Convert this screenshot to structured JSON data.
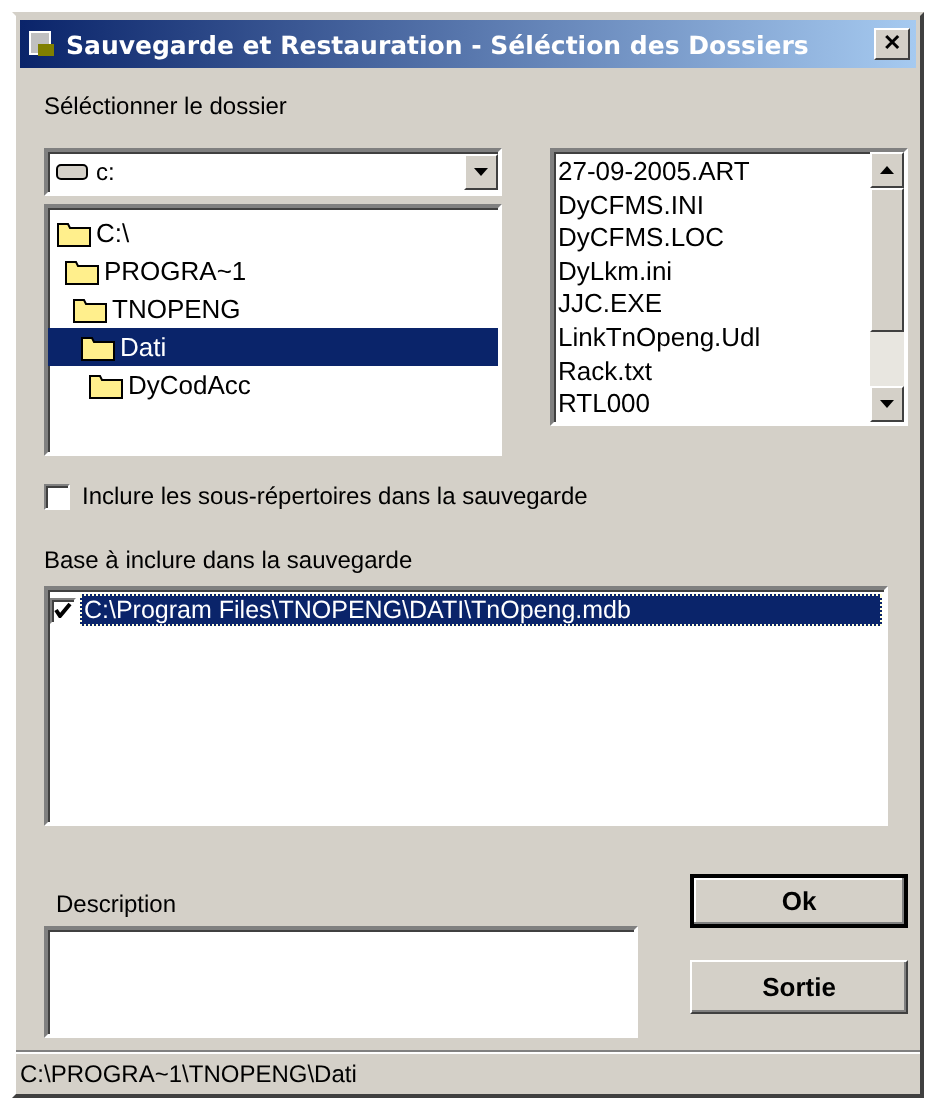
{
  "window": {
    "title": "Sauvegarde et Restauration - Séléction des Dossiers",
    "close": "✕"
  },
  "folder_label": "Séléctionner le dossier",
  "drive": {
    "value": "c:"
  },
  "tree": [
    {
      "label": "C:\\",
      "selected": false,
      "children": [
        {
          "label": "PROGRA~1",
          "selected": false,
          "children": [
            {
              "label": "TNOPENG",
              "selected": false,
              "children": [
                {
                  "label": "Dati",
                  "selected": true,
                  "children": [
                    {
                      "label": "DyCodAcc",
                      "selected": false
                    }
                  ]
                }
              ]
            }
          ]
        }
      ]
    }
  ],
  "files": [
    {
      "name": "27-09-2005.ART",
      "selected": false
    },
    {
      "name": "DyCFMS.INI",
      "selected": false
    },
    {
      "name": "DyCFMS.LOC",
      "selected": false
    },
    {
      "name": "DyLkm.ini",
      "selected": false
    },
    {
      "name": "JJC.EXE",
      "selected": false
    },
    {
      "name": "LinkTnOpeng.Udl",
      "selected": false
    },
    {
      "name": "Rack.txt",
      "selected": false
    },
    {
      "name": "RTL000",
      "selected": false
    }
  ],
  "include_subfolders": {
    "label": "Inclure les sous-répertoires dans la sauvegarde",
    "checked": false
  },
  "base_label": "Base  à inclure dans la sauvegarde",
  "bases": [
    {
      "path": "C:\\Program Files\\TNOPENG\\DATI\\TnOpeng.mdb",
      "checked": true,
      "selected": true
    }
  ],
  "description_label": "Description",
  "buttons": [
    {
      "label": "Ok",
      "kind": "default"
    },
    {
      "label": "Sortie",
      "kind": "normal"
    }
  ],
  "status_bar": "C:\\PROGRA~1\\TNOPENG\\Dati"
}
